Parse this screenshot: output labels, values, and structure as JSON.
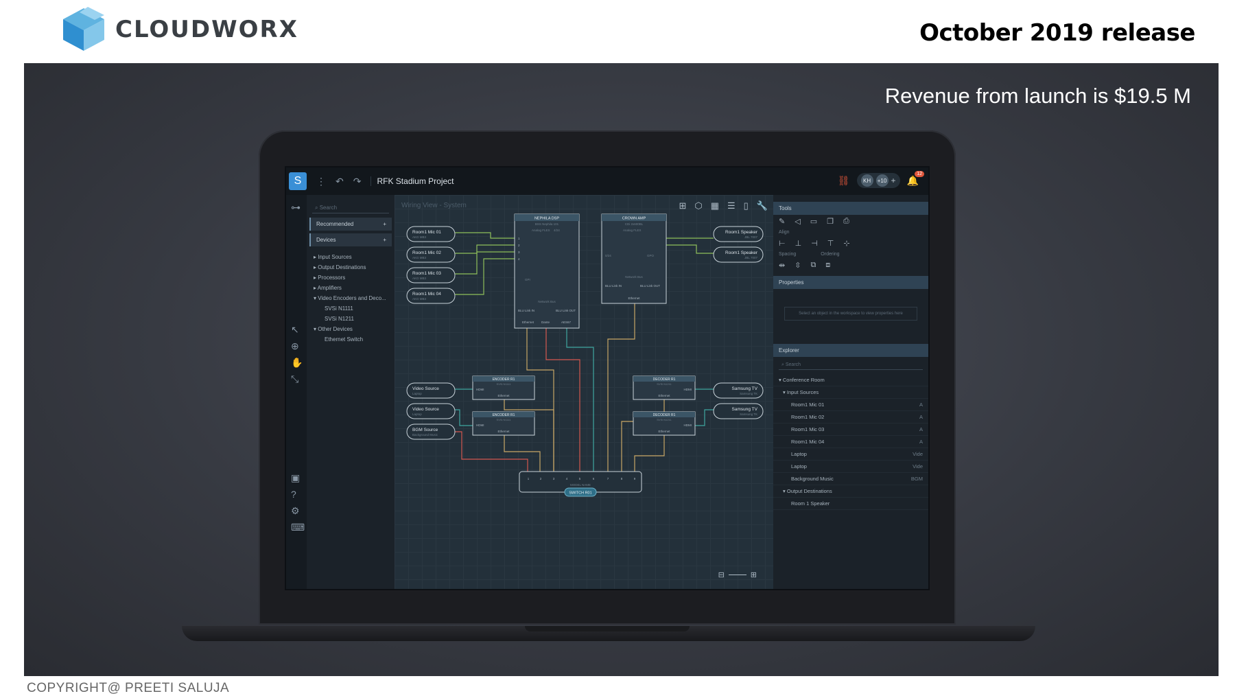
{
  "brand": {
    "name": "CLOUDWORX",
    "logo_icon": "cube-icon"
  },
  "slide": {
    "release_title": "October 2019 release",
    "revenue": "Revenue from launch is $19.5 M",
    "copyright": "COPYRIGHT@ PREETI SALUJA"
  },
  "app": {
    "logo_letter": "S",
    "project_title": "RFK Stadium Project",
    "users": {
      "initials": "KH",
      "more": "+10"
    },
    "notification_count": "12",
    "view_label": "Wiring View - System",
    "left_panel": {
      "search_placeholder": "Search",
      "recommended": "Recommended",
      "devices": "Devices",
      "tree": [
        "Input Sources",
        "Output Destinations",
        "Processors",
        "Amplifiers",
        "Video Encoders and Deco..."
      ],
      "encoders": [
        "SVSi N1111",
        "SVSi N1211"
      ],
      "other": "Other Devices",
      "other_children": [
        "Ethernet Switch"
      ]
    },
    "right_panel": {
      "tools": "Tools",
      "align": "Align",
      "spacing": "Spacing",
      "ordering": "Ordering",
      "properties": "Properties",
      "properties_hint": "Select an object in the workspace to view properties here",
      "explorer": "Explorer",
      "search_placeholder": "Search",
      "conference_room": "Conference Room",
      "input_sources": "Input Sources",
      "inputs": [
        {
          "name": "Room1 Mic 01",
          "tag": "A"
        },
        {
          "name": "Room1 Mic 02",
          "tag": "A"
        },
        {
          "name": "Room1 Mic 03",
          "tag": "A"
        },
        {
          "name": "Room1 Mic 04",
          "tag": "A"
        },
        {
          "name": "Laptop",
          "tag": "Vide"
        },
        {
          "name": "Laptop",
          "tag": "Vide"
        },
        {
          "name": "Background Music",
          "tag": "BGM"
        }
      ],
      "output_destinations": "Output Destinations",
      "outputs": [
        "Room 1 Speaker"
      ]
    },
    "diagram": {
      "mics": [
        {
          "name": "Room1 Mic 01",
          "model": "AKG MB3"
        },
        {
          "name": "Room1 Mic 02",
          "model": "AKG MB3"
        },
        {
          "name": "Room1 Mic 03",
          "model": "AKG MB3"
        },
        {
          "name": "Room1 Mic 04",
          "model": "AKG MB3"
        }
      ],
      "speakers": [
        {
          "name": "Room1 Speaker",
          "model": "JBL 7007"
        },
        {
          "name": "Room1 Speaker",
          "model": "JBL 7007"
        }
      ],
      "dsp": {
        "title": "NEPHILA DSP",
        "model": "BSS Nephila 101",
        "sub": "Analog FLEX",
        "ch": "4/24",
        "gpi": "GPI",
        "bus": "Network Bus",
        "blu_in": "BLU Link IN",
        "blu_out": "BLU Link OUT",
        "p1": "Ethernet",
        "p2": "Dante",
        "p3": "AES67"
      },
      "amp": {
        "title": "CROWN AMP",
        "model": "CDi 2x600BL",
        "sub": "Analog FLEX",
        "ch": "0/24",
        "gpi": "GPO",
        "bus": "Network Bus",
        "blu_in": "BLU Link IN",
        "blu_out": "BLU Link OUT",
        "p1": "Ethernet"
      },
      "sources": [
        {
          "name": "Video Source",
          "model": "Laptop"
        },
        {
          "name": "Video Source",
          "model": "Laptop"
        },
        {
          "name": "BGM Source",
          "model": "Background Music"
        }
      ],
      "encoders": [
        {
          "title": "ENCODER R1",
          "model": "SVSi N1111",
          "hdmi": "HDMI",
          "eth": "Ethernet"
        },
        {
          "title": "ENCODER R1",
          "model": "SVSi N1111",
          "hdmi": "HDMI",
          "eth": "Ethernet"
        }
      ],
      "decoders": [
        {
          "title": "DECODER R1",
          "model": "SVSi N1211",
          "hdmi": "HDMI",
          "eth": "Ethernet"
        },
        {
          "title": "DECODER R1",
          "model": "SVSi N1211",
          "hdmi": "HDMI",
          "eth": "Ethernet"
        }
      ],
      "tvs": [
        {
          "name": "Samsung TV",
          "model": "Samsung TK"
        },
        {
          "name": "Samsung TV",
          "model": "Samsung TK"
        }
      ],
      "switch": {
        "label": "SWITCH R01",
        "model": "MODEL NAME",
        "ports": [
          "1",
          "2",
          "3",
          "4",
          "5",
          "6",
          "7",
          "8",
          "9"
        ]
      }
    }
  },
  "colors": {
    "accent": "#3a8fd6",
    "wire_yellow": "#c9a766",
    "wire_red": "#d4574f",
    "wire_teal": "#3fa7a0",
    "wire_green": "#8fbf5a",
    "node_stroke": "#c9d3da"
  }
}
